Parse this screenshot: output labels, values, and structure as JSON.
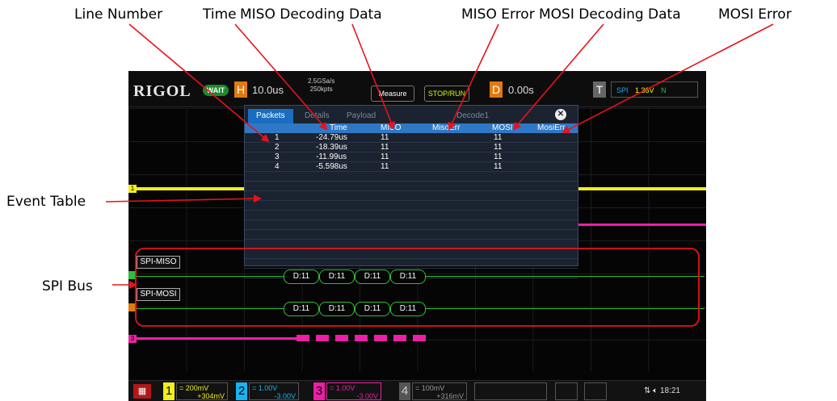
{
  "callouts": {
    "line_number": "Line Number",
    "time": "Time",
    "miso_data": "MISO Decoding Data",
    "miso_error": "MISO Error",
    "mosi_data": "MOSI Decoding Data",
    "mosi_error": "MOSI Error",
    "event_table": "Event Table",
    "spi_bus": "SPI  Bus"
  },
  "scope": {
    "brand": "RIGOL",
    "run_state": "WAIT",
    "horizontal": {
      "letter": "H",
      "timebase": "10.0us",
      "sample_rate": "2.5GSa/s",
      "memory_depth": "250kpts"
    },
    "buttons": {
      "measure": "Measure",
      "stop_run": "STOP/RUN"
    },
    "delay": {
      "letter": "D",
      "value": "0.00s"
    },
    "trigger": {
      "letter": "T",
      "source": "SPI",
      "level": "1.36V",
      "mode": "N"
    },
    "colors": {
      "ch1": "#f3ee1b",
      "ch2": "#16b4f0",
      "ch3": "#ec1fa6",
      "ch4": "#2f6ae0",
      "bus": "#2fbf3a",
      "accent": "#1a6ec0"
    }
  },
  "event_table": {
    "tabs": [
      "Packets",
      "Details",
      "Payload",
      "Decode1"
    ],
    "headers": [
      "",
      "Time",
      "MISO",
      "MisoErr",
      "MOSI",
      "MosiErr"
    ],
    "rows": [
      [
        "1",
        "-24.79us",
        "11",
        "",
        "11",
        ""
      ],
      [
        "2",
        "-18.39us",
        "11",
        "",
        "11",
        ""
      ],
      [
        "3",
        "-11.99us",
        "11",
        "",
        "11",
        ""
      ],
      [
        "4",
        "-5.598us",
        "11",
        "",
        "11",
        ""
      ]
    ]
  },
  "bus": {
    "miso_label": "SPI-MISO",
    "mosi_label": "SPI-MOSI",
    "miso_packets": [
      "D:11",
      "D:11",
      "D:11",
      "D:11"
    ],
    "mosi_packets": [
      "D:11",
      "D:11",
      "D:11",
      "D:11"
    ]
  },
  "bottom": {
    "ch1": {
      "num": "1",
      "scale": "= 200mV",
      "offset": "+304mV"
    },
    "ch2": {
      "num": "2",
      "scale": "= 1.00V",
      "offset": "-3.00V"
    },
    "ch3": {
      "num": "3",
      "scale": "= 1.00V",
      "offset": "-3.00V"
    },
    "ch4": {
      "num": "4",
      "scale": "= 100mV",
      "offset": "+316mV"
    },
    "time": "18:21"
  }
}
